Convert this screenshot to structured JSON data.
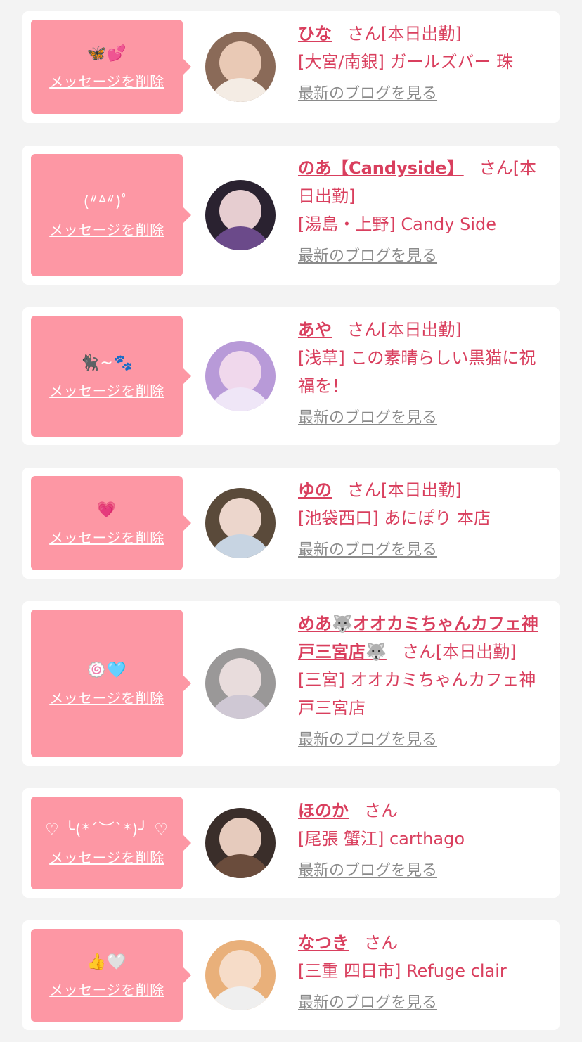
{
  "delete_label": "メッセージを削除",
  "san_label": "さん",
  "today_label": "[本日出勤]",
  "blog_label": "最新のブログを見る",
  "colors": {
    "accent": "#d93f5e",
    "bubble": "#fd97a4",
    "muted": "#8a8a8a"
  },
  "cards": [
    {
      "message": "🦋💕",
      "name": "ひな",
      "today": true,
      "area_shop": "[大宮/南銀] ガールズバー 珠"
    },
    {
      "message": "(ᐥᐞᐥ)ﾟ",
      "name": "のあ【Candyside】",
      "today": true,
      "area_shop": "[湯島・上野] Candy Side"
    },
    {
      "message": "🐈‍⬛~🐾",
      "name": "あや",
      "today": true,
      "area_shop": "[浅草] この素晴らしい黒猫に祝福を！"
    },
    {
      "message": "💗",
      "name": "ゆの",
      "today": true,
      "area_shop": "[池袋西口] あにぽり 本店"
    },
    {
      "message": "🍥🩵",
      "name": "めあ🐺オオカミちゃんカフェ神戸三宮店🐺",
      "today": true,
      "area_shop": "[三宮] オオカミちゃんカフェ神戸三宮店"
    },
    {
      "message": "♡ ╰(*´︶`*)╯ ♡",
      "name": "ほのか",
      "today": false,
      "area_shop": "[尾張 蟹江] carthago"
    },
    {
      "message": "👍🤍",
      "name": "なつき",
      "today": false,
      "area_shop": "[三重 四日市] Refuge clair"
    }
  ]
}
